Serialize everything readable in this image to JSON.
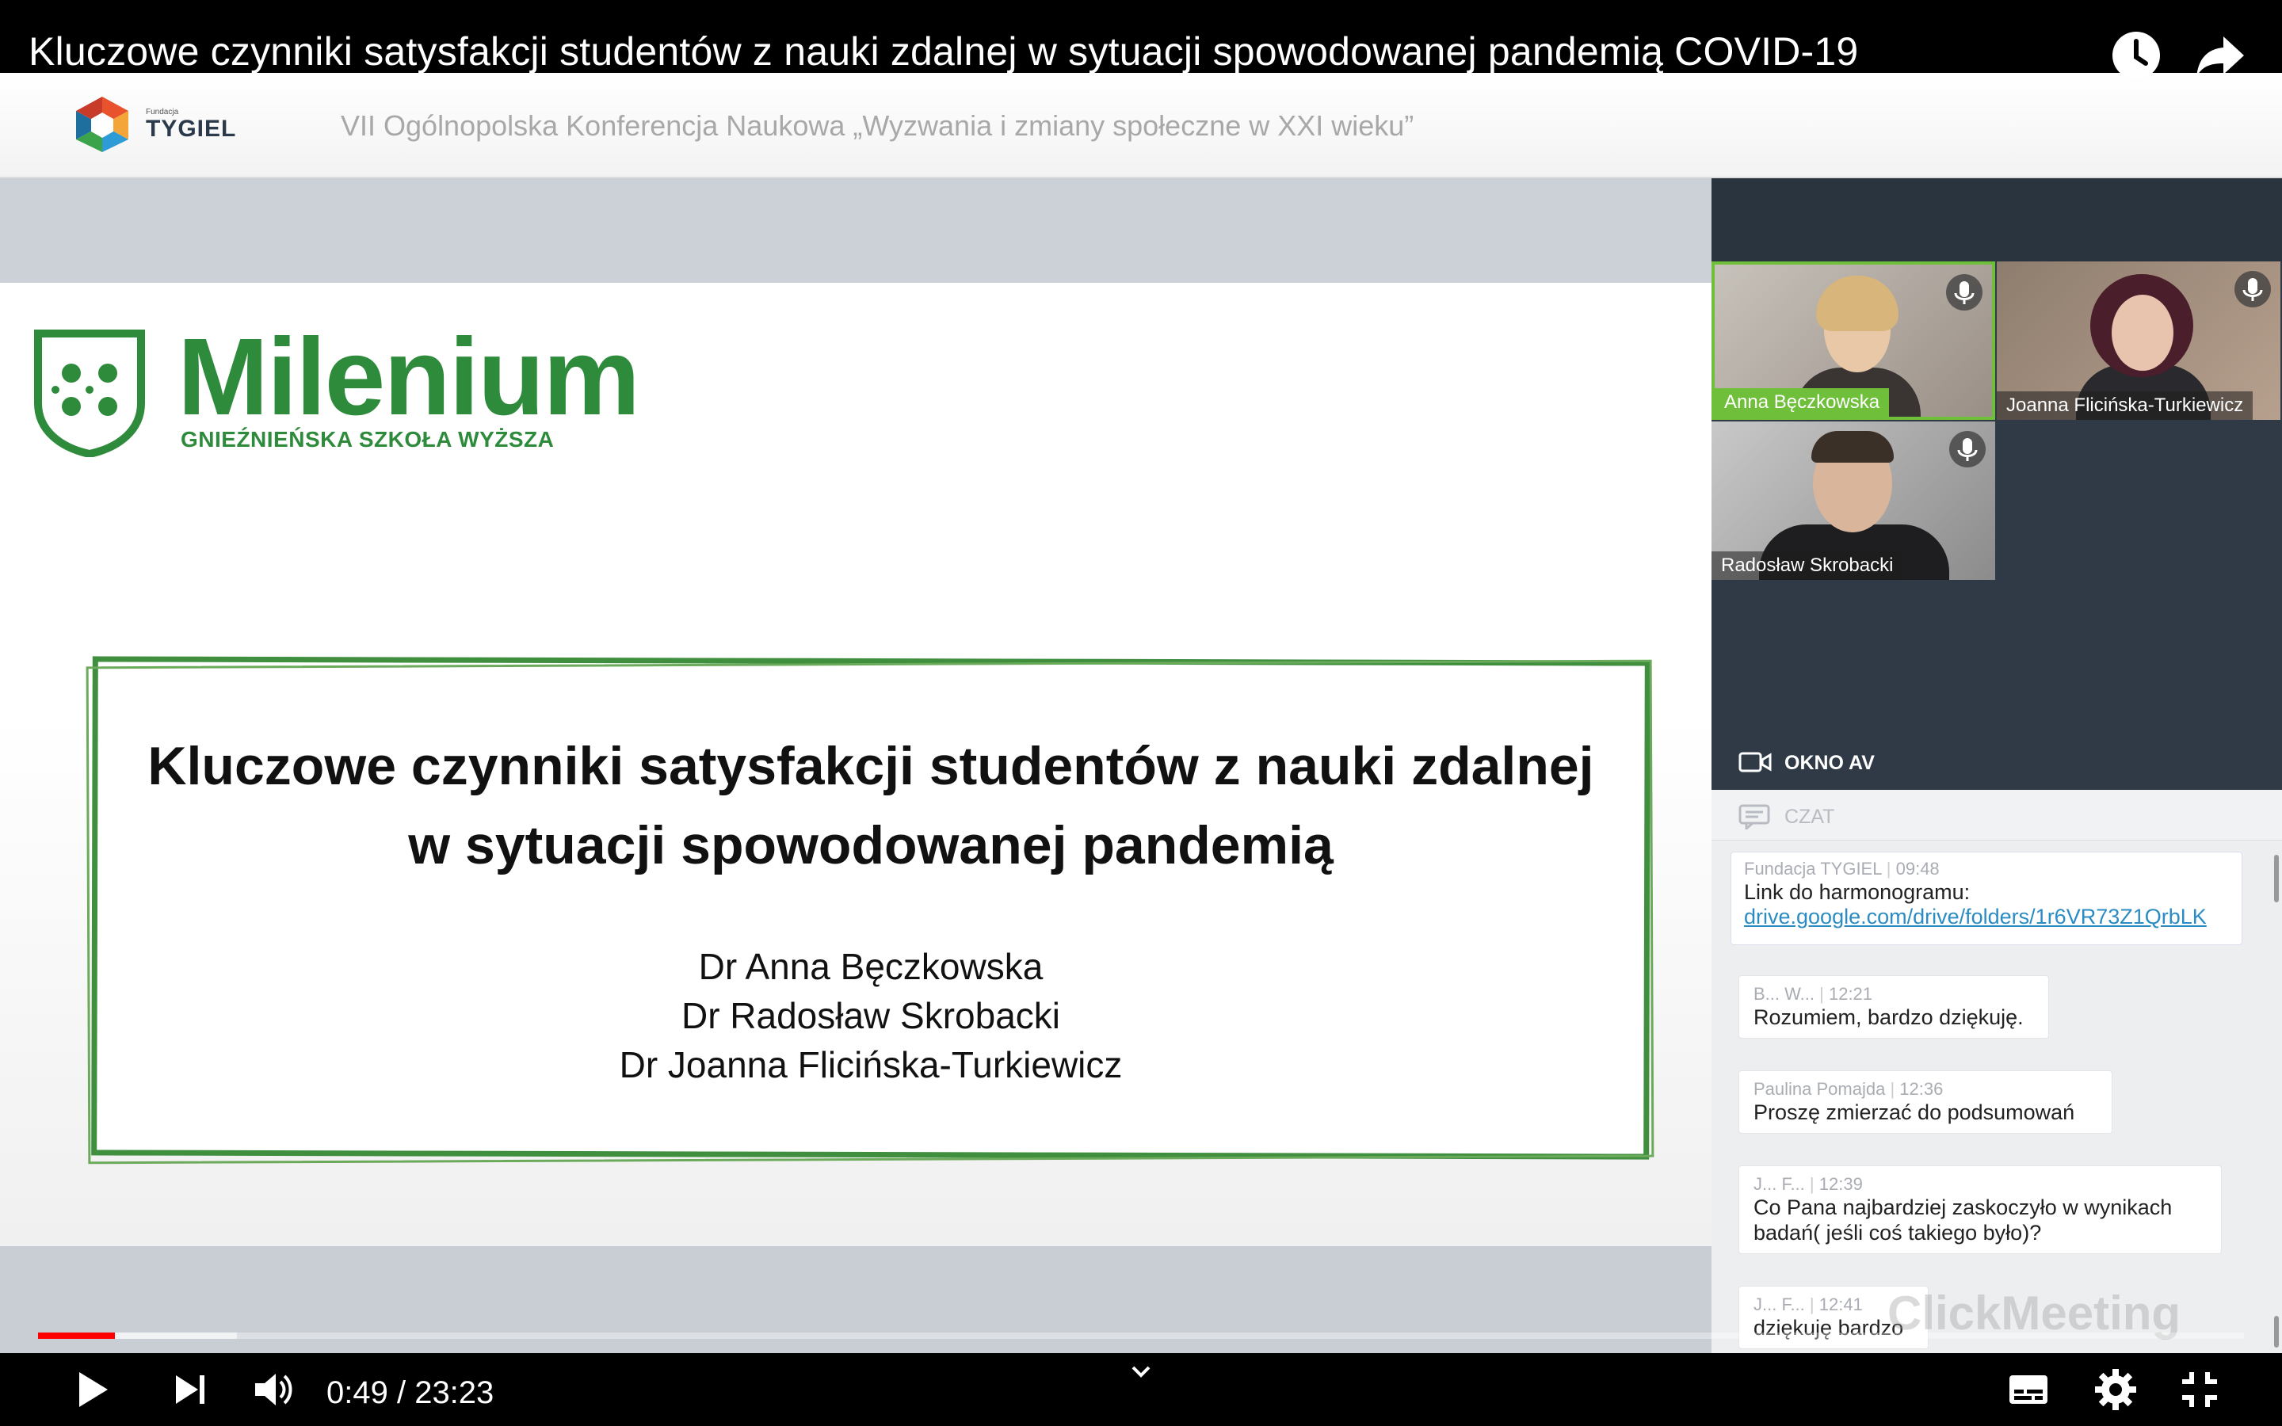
{
  "video": {
    "title": "Kluczowe czynniki satysfakcji studentów z nauki zdalnej w sytuacji spowodowanej pandemią COVID-19",
    "top_icons": [
      "clock-icon",
      "share-icon"
    ]
  },
  "conference": {
    "logo_small": "Fundacja",
    "logo_text": "TYGIEL",
    "title": "VII Ogólnopolska Konferencja Naukowa „Wyzwania i zmiany społeczne w XXI wieku”"
  },
  "slide": {
    "brand_name": "Milenium",
    "brand_sub": "GNIEŹNIEŃSKA SZKOŁA WYŻSZA",
    "title_line1": "Kluczowe czynniki satysfakcji studentów z nauki zdalnej",
    "title_line2": "w sytuacji spowodowanej pandemią",
    "authors": [
      "Dr Anna Bęczkowska",
      "Dr Radosław Skrobacki",
      "Dr Joanna Flicińska-Turkiewicz"
    ],
    "brand_color": "#2e8b3b"
  },
  "participants": [
    {
      "name": "Anna Bęczkowska",
      "active": true
    },
    {
      "name": "Joanna Flicińska-Turkiewicz",
      "active": false
    },
    {
      "name": "Radosław Skrobacki",
      "active": false
    }
  ],
  "panel": {
    "av_label": "OKNO AV",
    "chat_label": "CZAT",
    "watermark": "ClickMeeting",
    "pinned": {
      "author": "Fundacja TYGIEL",
      "time": "09:48",
      "text": "Link do harmonogramu:",
      "link": "drive.google.com/drive/folders/1r6VR73Z1QrbLK"
    },
    "messages": [
      {
        "author": "B... W...",
        "time": "12:21",
        "text": "Rozumiem, bardzo dziękuję."
      },
      {
        "author": "Paulina Pomajda",
        "time": "12:36",
        "text": "Proszę zmierzać do podsumowań"
      },
      {
        "author": "J... F...",
        "time": "12:39",
        "text": "Co Pana najbardziej zaskoczyło w wynikach badań( jeśli coś takiego było)?"
      },
      {
        "author": "J... F...",
        "time": "12:41",
        "text": "dziękuję bardzo"
      }
    ]
  },
  "player": {
    "current_time": "0:49",
    "separator": "/",
    "duration": "23:23",
    "time_display": "0:49 / 23:23",
    "played_fraction": 0.035,
    "buffered_fraction": 0.09,
    "progress_color": "#ff0000",
    "controls": [
      "play-icon",
      "next-icon",
      "volume-icon",
      "subtitles-icon",
      "settings-icon",
      "exit-fullscreen-icon"
    ]
  }
}
